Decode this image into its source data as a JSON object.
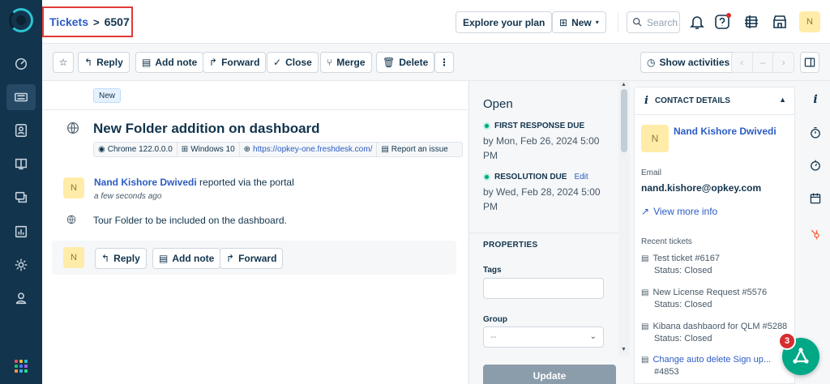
{
  "nav": {
    "items": [
      "dashboard",
      "tickets",
      "contacts",
      "solutions",
      "forums",
      "reports",
      "admin",
      "profile"
    ],
    "active": "tickets"
  },
  "header": {
    "breadcrumb_link": "Tickets",
    "breadcrumb_sep": ">",
    "ticket_id": "6507",
    "explore_label": "Explore your plan",
    "new_label": "New",
    "search_placeholder": "Search",
    "avatar_initial": "N"
  },
  "toolbar": {
    "reply": "Reply",
    "add_note": "Add note",
    "forward": "Forward",
    "close": "Close",
    "merge": "Merge",
    "delete": "Delete",
    "more": "⋮",
    "show_activities": "Show activities",
    "pager_prev": "‹",
    "pager_mid": "–",
    "pager_next": "›"
  },
  "ticket": {
    "status_tag": "New",
    "title": "New Folder addition on dashboard",
    "browser": "Chrome 122.0.0.0",
    "os": "Windows 10",
    "url": "https://opkey-one.freshdesk.com/",
    "report_issue": "Report an issue",
    "requester_initial": "N",
    "requester_name": "Nand Kishore Dwivedi",
    "requester_via": " reported via the portal",
    "requested_time": "a few seconds ago",
    "description": "Tour Folder to be included on the dashboard.",
    "reply_initial": "N",
    "reply": "Reply",
    "add_note": "Add note",
    "forward": "Forward"
  },
  "properties": {
    "state": "Open",
    "first_response_label": "FIRST RESPONSE DUE",
    "first_response_date": "by Mon, Feb 26, 2024 5:00 PM",
    "resolution_label": "RESOLUTION DUE",
    "resolution_edit": "Edit",
    "resolution_date": "by Wed, Feb 28, 2024 5:00 PM",
    "section_title": "PROPERTIES",
    "tags_label": "Tags",
    "group_label": "Group",
    "group_value": "--",
    "update_button": "Update"
  },
  "contact": {
    "header": "CONTACT DETAILS",
    "initial": "N",
    "name": "Nand Kishore Dwivedi",
    "email_label": "Email",
    "email": "nand.kishore@opkey.com",
    "view_more": "View more info",
    "recent_label": "Recent tickets",
    "recent": [
      {
        "title": "Test ticket #6167",
        "status": "Status: Closed"
      },
      {
        "title": "New License Request #5576",
        "status": "Status: Closed"
      },
      {
        "title": "Kibana dashbaord for QLM #5288",
        "status": "Status: Closed"
      },
      {
        "title": "Change auto delete Sign up...",
        "status": "#4853"
      }
    ]
  },
  "widget": {
    "badge": "3"
  },
  "colors": {
    "nav_bg": "#12344d",
    "link": "#2c5cc5",
    "highlight_border": "#e03a3a",
    "success": "#00a886"
  }
}
